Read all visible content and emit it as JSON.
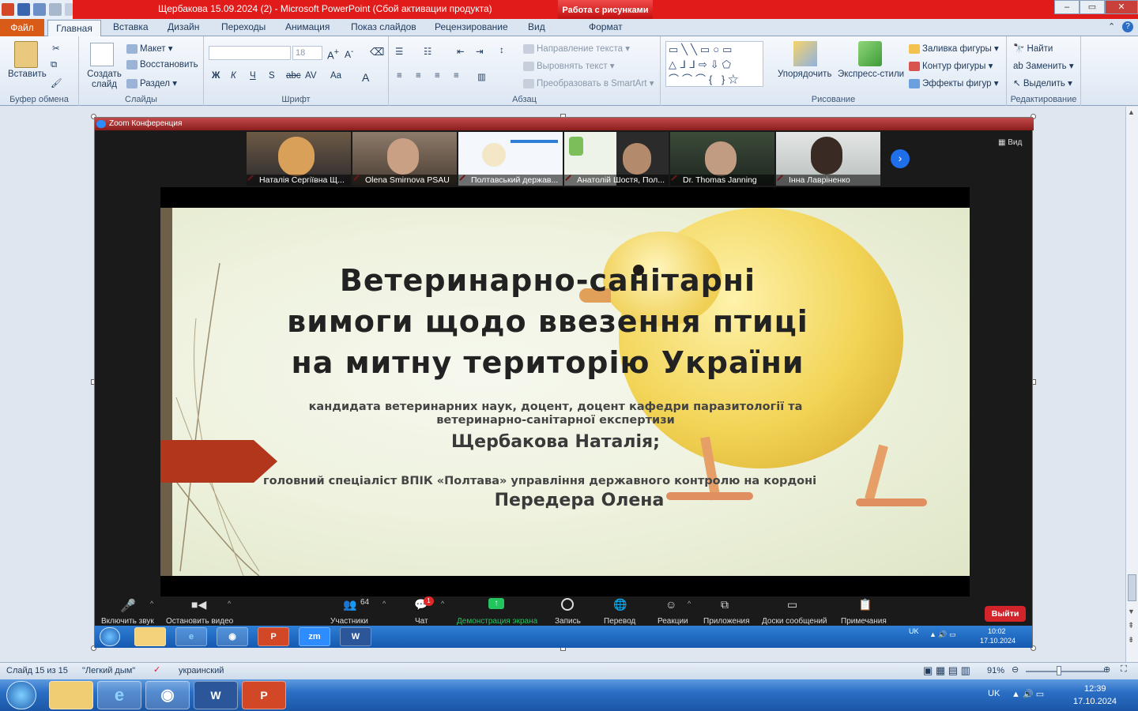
{
  "window": {
    "title": "Щербакова 15.09.2024 (2)  -  Microsoft PowerPoint (Сбой активации продукта)",
    "context_tab": "Работа с рисунками"
  },
  "ribbon_tabs": [
    "Файл",
    "Главная",
    "Вставка",
    "Дизайн",
    "Переходы",
    "Анимация",
    "Показ слайдов",
    "Рецензирование",
    "Вид",
    "Формат"
  ],
  "ribbon": {
    "clipboard": {
      "paste": "Вставить",
      "label": "Буфер обмена"
    },
    "slides": {
      "create": "Создать слайд",
      "layout": "Макет",
      "reset": "Восстановить",
      "section": "Раздел",
      "label": "Слайды"
    },
    "font": {
      "size": "18",
      "label": "Шрифт"
    },
    "paragraph": {
      "text_direction": "Направление текста",
      "align_text": "Выровнять текст",
      "smartart": "Преобразовать в SmartArt",
      "label": "Абзац"
    },
    "drawing": {
      "arrange": "Упорядочить",
      "quick_styles": "Экспресс-стили",
      "fill": "Заливка фигуры",
      "outline": "Контур фигуры",
      "effects": "Эффекты фигур",
      "label": "Рисование"
    },
    "editing": {
      "find": "Найти",
      "replace": "Заменить",
      "select": "Выделить",
      "label": "Редактирование"
    }
  },
  "zoom": {
    "window_title": "Zoom Конференция",
    "view_label": "Вид",
    "participants": [
      "Наталія Сергіївна Щ...",
      "Olena Smirnova PSAU",
      "Полтавський держав...",
      "Анатолій Шостя, Пол...",
      "Dr. Thomas Janning",
      "Інна Лавріненко"
    ],
    "controls": {
      "unmute": "Включить звук",
      "stop_video": "Остановить видео",
      "participants": "Участники",
      "participants_count": "64",
      "chat": "Чат",
      "chat_badge": "1",
      "share": "Демонстрация экрана",
      "record": "Запись",
      "translate": "Перевод",
      "reactions": "Реакции",
      "apps": "Приложения",
      "whiteboards": "Доски сообщений",
      "notes": "Примечания",
      "leave": "Выйти"
    },
    "taskbar": {
      "lang": "UK",
      "time": "10:02",
      "date": "17.10.2024"
    }
  },
  "slide": {
    "title_lines": [
      "Ветеринарно-санітарні",
      "вимоги щодо ввезення птиці",
      "на митну територію України"
    ],
    "author1_desc_line1": "кандидата ветеринарних наук, доцент, доцент кафедри паразитології та",
    "author1_desc_line2": "ветеринарно-санітарної експертизи",
    "author1_name": "Щербакова Наталія;",
    "author2_desc": "головний спеціаліст ВПІК «Полтава» управління державного контролю на кордоні",
    "author2_name": "Передера Олена"
  },
  "statusbar": {
    "slide_info": "Слайд 15 из 15",
    "theme": "\"Легкий дым\"",
    "language": "украинский",
    "zoom": "91%"
  },
  "taskbar": {
    "lang": "UK",
    "time": "12:39",
    "date": "17.10.2024"
  },
  "colors": {
    "title_bar": "#e11a1a",
    "file_tab": "#d85c17",
    "slide_arrow": "#b2361c",
    "leave": "#d3232b",
    "share_green": "#22c55e"
  }
}
